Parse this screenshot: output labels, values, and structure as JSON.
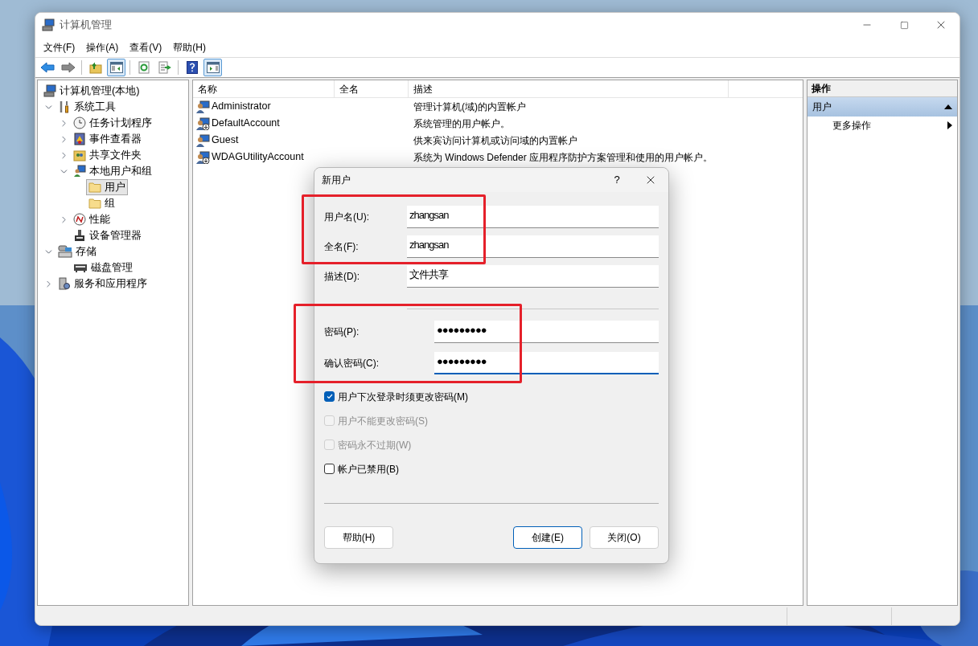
{
  "window": {
    "title": "计算机管理"
  },
  "menu": [
    "文件(F)",
    "操作(A)",
    "查看(V)",
    "帮助(H)"
  ],
  "toolbar": [
    {
      "kind": "back",
      "pressed": false
    },
    {
      "kind": "forward",
      "pressed": false
    },
    {
      "kind": "sep"
    },
    {
      "kind": "up",
      "pressed": false
    },
    {
      "kind": "tree",
      "pressed": true
    },
    {
      "kind": "sep"
    },
    {
      "kind": "refresh",
      "pressed": false
    },
    {
      "kind": "export",
      "pressed": false
    },
    {
      "kind": "sep"
    },
    {
      "kind": "help",
      "pressed": false
    },
    {
      "kind": "pane",
      "pressed": true
    }
  ],
  "tree": [
    {
      "label": "计算机管理(本地)",
      "kind": "computer",
      "selected": false,
      "children": [
        {
          "label": "系统工具",
          "kind": "tools",
          "expanded": true,
          "selected": false,
          "children": [
            {
              "label": "任务计划程序",
              "kind": "clock",
              "expanded": false,
              "selected": false
            },
            {
              "label": "事件查看器",
              "kind": "events",
              "expanded": false,
              "selected": false
            },
            {
              "label": "共享文件夹",
              "kind": "share",
              "expanded": false,
              "selected": false
            },
            {
              "label": "本地用户和组",
              "kind": "users",
              "expanded": true,
              "selected": false,
              "children": [
                {
                  "label": "用户",
                  "kind": "folder",
                  "selected": true
                },
                {
                  "label": "组",
                  "kind": "folder",
                  "selected": false
                }
              ]
            },
            {
              "label": "性能",
              "kind": "perf",
              "expanded": false,
              "selected": false
            },
            {
              "label": "设备管理器",
              "kind": "device",
              "selected": false
            }
          ]
        },
        {
          "label": "存储",
          "kind": "storage",
          "expanded": true,
          "selected": false,
          "children": [
            {
              "label": "磁盘管理",
              "kind": "disk",
              "selected": false
            }
          ]
        },
        {
          "label": "服务和应用程序",
          "kind": "services",
          "expanded": false,
          "selected": false
        }
      ]
    }
  ],
  "table": {
    "columns": [
      "名称",
      "全名",
      "描述"
    ],
    "rows": [
      {
        "name": "Administrator",
        "disabled": false,
        "description": "管理计算机(域)的内置帐户"
      },
      {
        "name": "DefaultAccount",
        "disabled": true,
        "description": "系统管理的用户帐户。"
      },
      {
        "name": "Guest",
        "disabled": false,
        "description": "供来宾访问计算机或访问域的内置帐户"
      },
      {
        "name": "WDAGUtilityAccount",
        "disabled": true,
        "description": "系统为 Windows Defender 应用程序防护方案管理和使用的用户帐户。"
      }
    ]
  },
  "actions": {
    "header": "操作",
    "sections": [
      {
        "title": "用户",
        "expanded": true,
        "items": [
          {
            "label": "更多操作",
            "submenu": true
          }
        ]
      }
    ]
  },
  "dialog": {
    "title": "新用户",
    "help_glyph": "?",
    "sections": [
      [
        {
          "highlighted": true,
          "fields": [
            {
              "label": "用户名(U):",
              "value": "zhangsan",
              "focused": false
            },
            {
              "label": "全名(F):",
              "value": "zhangsan",
              "focused": false
            }
          ]
        },
        {
          "highlighted": false,
          "fields": [
            {
              "label": "描述(D):",
              "value": "文件共享",
              "focused": false
            }
          ]
        }
      ],
      [
        {
          "highlighted": true,
          "fields": [
            {
              "label": "密码(P):",
              "value": "●●●●●●●●●",
              "focused": false
            },
            {
              "label": "确认密码(C):",
              "value": "●●●●●●●●●",
              "focused": true
            }
          ]
        }
      ]
    ],
    "options": [
      {
        "label": "用户下次登录时须更改密码(M)",
        "checked": true,
        "disabled": false
      },
      {
        "label": "用户不能更改密码(S)",
        "checked": false,
        "disabled": true
      },
      {
        "label": "密码永不过期(W)",
        "checked": false,
        "disabled": true
      },
      {
        "label": "帐户已禁用(B)",
        "checked": false,
        "disabled": false
      }
    ],
    "buttons": [
      {
        "label": "帮助(H)",
        "default": false
      },
      {
        "label": "创建(E)",
        "default": true
      },
      {
        "label": "关闭(O)",
        "default": false
      }
    ]
  }
}
